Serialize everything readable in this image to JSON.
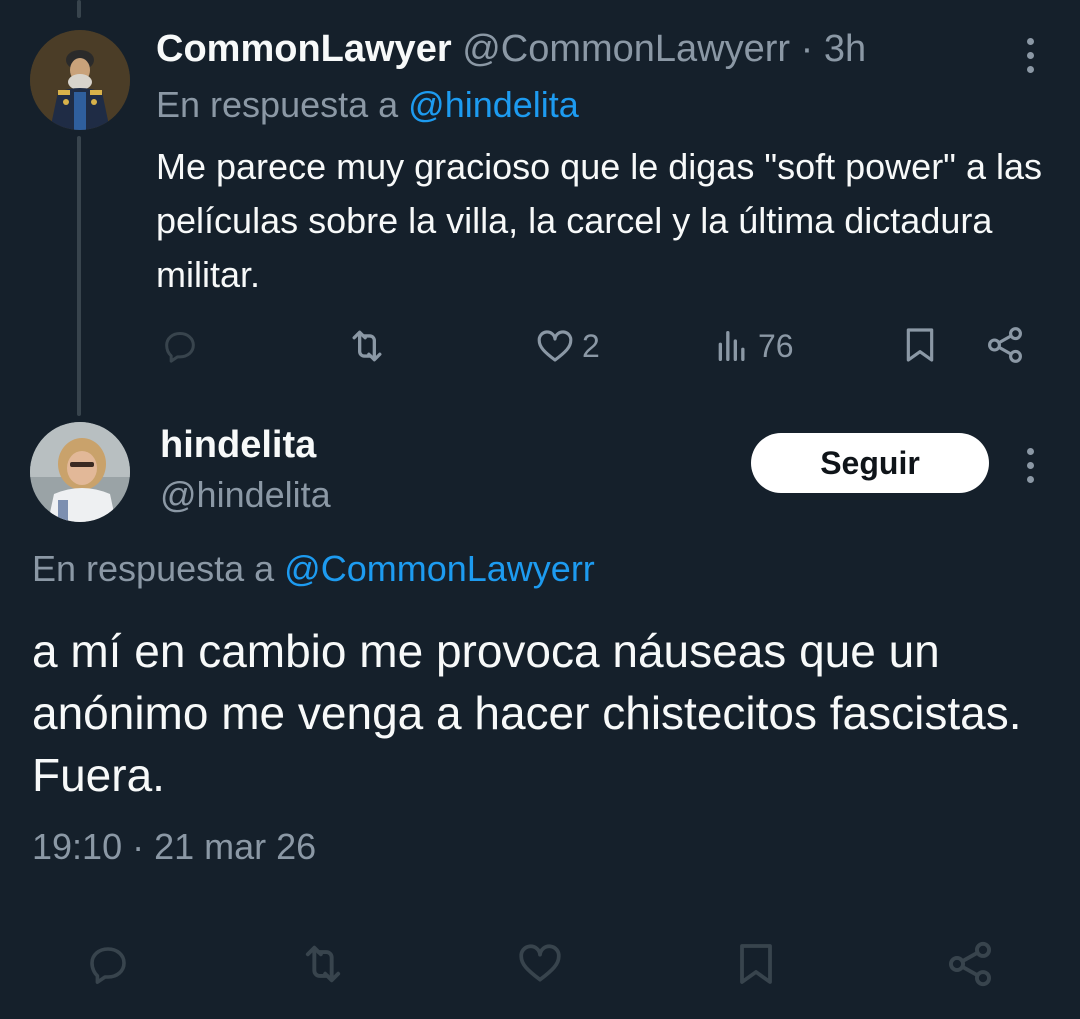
{
  "reply_tweet": {
    "display_name": "CommonLawyer",
    "handle": "@CommonLawyerr",
    "separator": "·",
    "time_ago": "3h",
    "in_reply_prefix": "En respuesta a",
    "in_reply_handle": "@hindelita",
    "text": "Me parece muy gracioso que le digas \"soft power\" a las películas sobre la villa, la carcel y la última dictadura militar.",
    "actions": {
      "replies_icon": "reply-icon",
      "retweets_icon": "retweet-icon",
      "likes_icon": "heart-icon",
      "likes_count": "2",
      "views_icon": "views-icon",
      "views_count": "76",
      "bookmark_icon": "bookmark-icon",
      "share_icon": "share-icon"
    }
  },
  "main_tweet": {
    "display_name": "hindelita",
    "handle": "@hindelita",
    "follow_label": "Seguir",
    "in_reply_prefix": "En respuesta a",
    "in_reply_handle": "@CommonLawyerr",
    "text": "a mí en cambio me provoca náuseas que un anónimo me venga a hacer chistecitos fascistas. Fuera.",
    "timestamp": "19:10 · 21 mar 26"
  },
  "colors": {
    "background": "#15202b",
    "text": "#f7f9f9",
    "muted": "#8b98a5",
    "link": "#1d9bf0",
    "thread_line": "#38444d",
    "follow_bg": "#ffffff"
  }
}
